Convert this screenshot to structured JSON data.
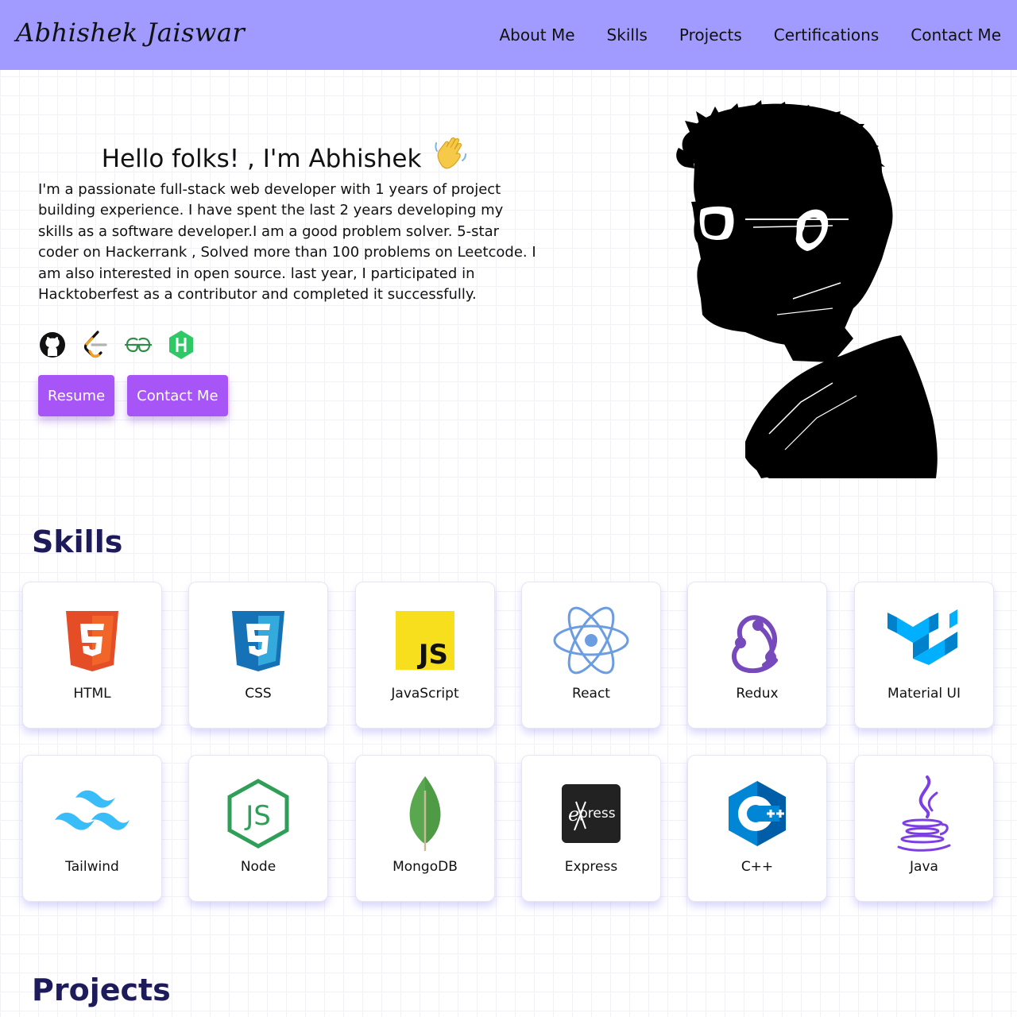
{
  "nav": {
    "brand": "Abhishek Jaiswar",
    "links": [
      "About Me",
      "Skills",
      "Projects",
      "Certifications",
      "Contact Me"
    ]
  },
  "hero": {
    "title": "Hello folks! , I'm Abhishek",
    "wave_emoji": "👋",
    "description": "I'm a passionate full-stack web developer with 1 years of project building experience. I have spent the last 2 years developing my skills as a software developer.I am a good problem solver. 5-star coder on Hackerrank , Solved more than 100 problems on Leetcode. I am also interested in open source. last year, I participated in Hacktoberfest as a contributor and completed it successfully.",
    "socials": [
      "github-icon",
      "leetcode-icon",
      "geeksforgeeks-icon",
      "hackerrank-icon"
    ],
    "buttons": {
      "resume": "Resume",
      "contact": "Contact Me"
    }
  },
  "skills": {
    "title": "Skills",
    "items": [
      "HTML",
      "CSS",
      "JavaScript",
      "React",
      "Redux",
      "Material UI",
      "Tailwind",
      "Node",
      "MongoDB",
      "Express",
      "C++",
      "Java"
    ]
  },
  "projects": {
    "title": "Projects"
  },
  "colors": {
    "navbar": "#a19bff",
    "button": "#a855f7",
    "heading": "#1e1b5b"
  }
}
